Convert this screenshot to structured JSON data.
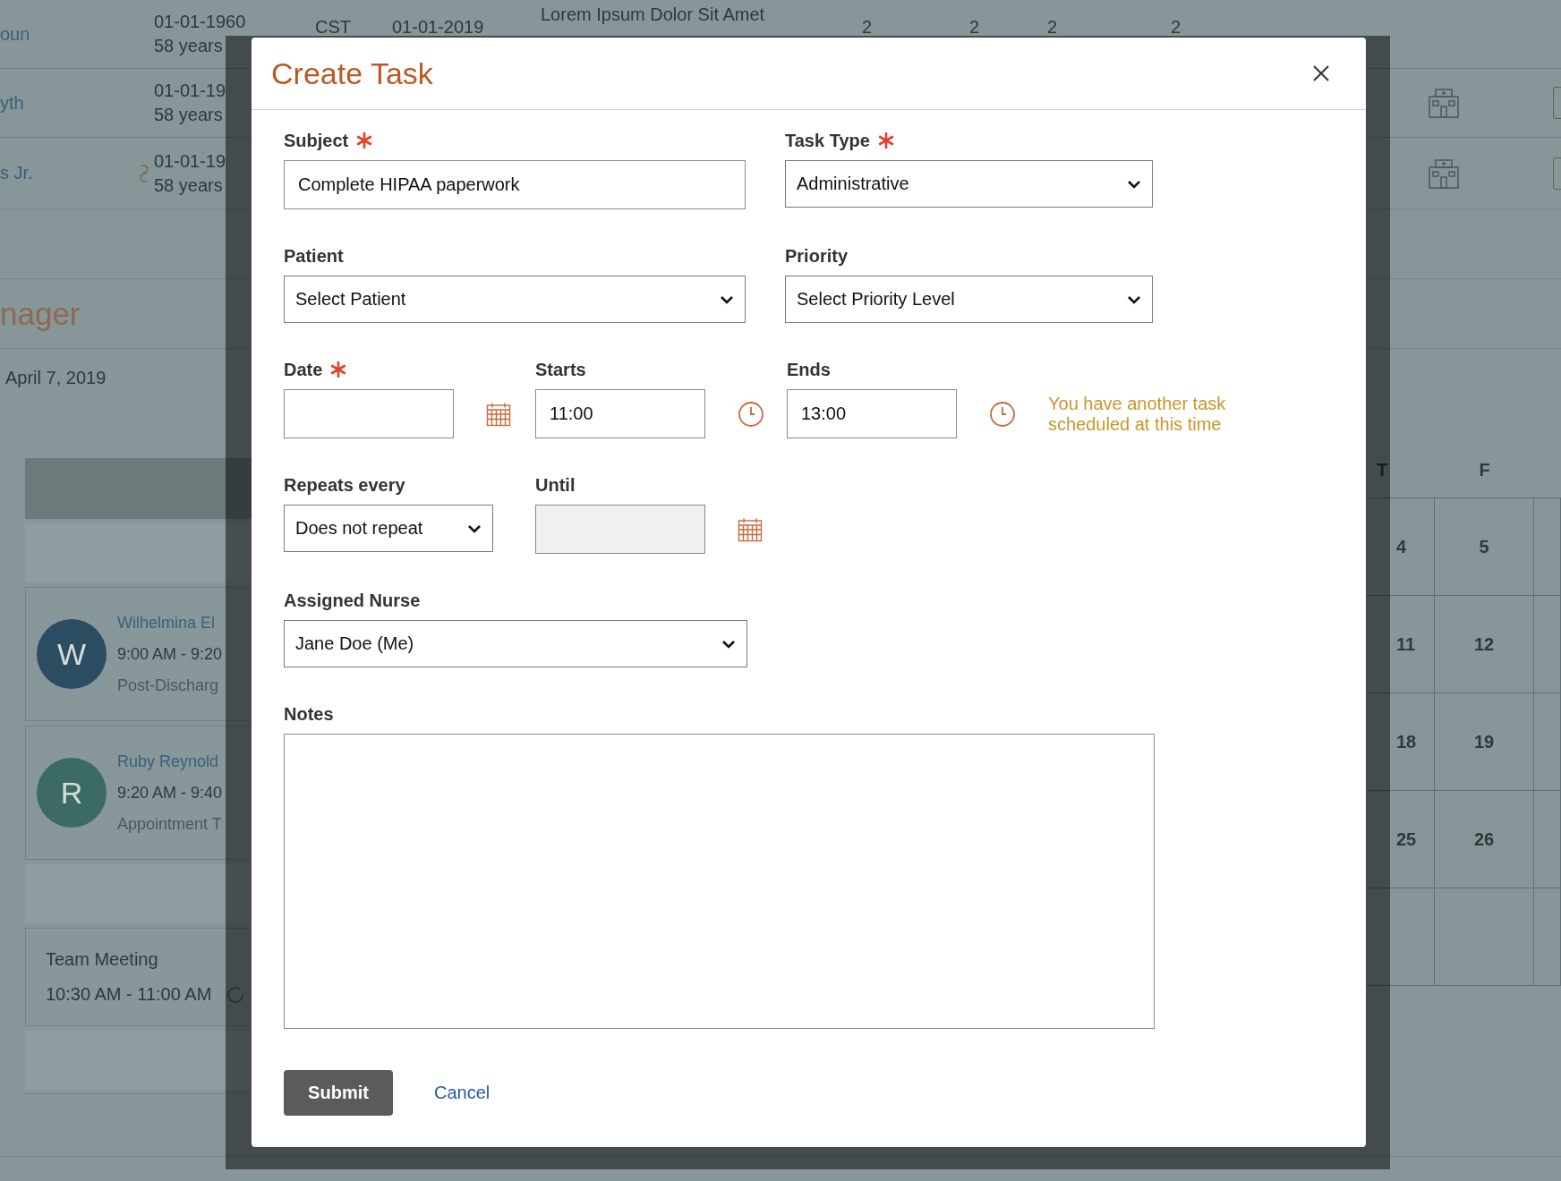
{
  "background": {
    "patient_table": {
      "rows": [
        {
          "name": "oun",
          "linked": false,
          "dob": "01-01-1960",
          "age": "58 years",
          "timezone": "CST",
          "date": "01-01-2019",
          "note": "Lorem Ipsum Dolor Sit Amet",
          "counts": [
            "2",
            "2",
            "2",
            "2"
          ],
          "facility": false
        },
        {
          "name": "yth",
          "linked": false,
          "dob": "01-01-19",
          "age": "58 years",
          "facility": true
        },
        {
          "name": "s Jr.",
          "linked": true,
          "dob": "01-01-19",
          "age": "58 years",
          "facility": true
        }
      ]
    },
    "schedule": {
      "title": "nager",
      "date": "April 7, 2019",
      "items": [
        {
          "kind": "bar"
        },
        {
          "kind": "slot"
        },
        {
          "kind": "appointment",
          "initial": "W",
          "color": "#2c4c62",
          "name": "Wilhelmina El",
          "time": "9:00 AM - 9:20",
          "description": "Post-Discharg"
        },
        {
          "kind": "appointment",
          "initial": "R",
          "color": "#3b6b63",
          "name": "Ruby Reynold",
          "time": "9:20 AM - 9:40",
          "description": "Appointment T"
        },
        {
          "kind": "slot"
        },
        {
          "kind": "event",
          "title": "Team Meeting",
          "time": "10:30 AM - 11:00 AM"
        },
        {
          "kind": "slot"
        }
      ]
    },
    "calendar": {
      "weekdays": [
        "T",
        "F"
      ],
      "weeks": [
        [
          "4",
          "5"
        ],
        [
          "11",
          "12"
        ],
        [
          "18",
          "19"
        ],
        [
          "25",
          "26"
        ]
      ]
    }
  },
  "dialog": {
    "title": "Create Task",
    "rows": [
      [
        {
          "kind": "text",
          "label": "Subject",
          "required": true,
          "value": "Complete HIPAA paperwork"
        },
        {
          "kind": "select",
          "label": "Task Type",
          "required": true,
          "value": "Administrative"
        }
      ],
      [
        {
          "kind": "select",
          "label": "Patient",
          "required": false,
          "value": "Select Patient"
        },
        {
          "kind": "select",
          "label": "Priority",
          "required": false,
          "value": "Select Priority Level"
        }
      ],
      [
        {
          "kind": "date",
          "label": "Date",
          "required": true,
          "disabled": false
        },
        {
          "kind": "time",
          "label": "Starts",
          "required": false,
          "value": "11:00"
        },
        {
          "kind": "time",
          "label": "Ends",
          "required": false,
          "value": "13:00",
          "warning": "You have another task scheduled at this time"
        }
      ],
      [
        {
          "kind": "select",
          "label": "Repeats every",
          "required": false,
          "value": "Does not repeat"
        },
        {
          "kind": "date",
          "label": "Until",
          "required": false,
          "disabled": true
        }
      ],
      [
        {
          "kind": "select",
          "label": "Assigned Nurse",
          "required": false,
          "value": "Jane Doe (Me)"
        }
      ],
      [
        {
          "kind": "textarea",
          "label": "Notes",
          "required": false
        }
      ]
    ],
    "buttons": [
      {
        "kind": "primary",
        "label": "Submit"
      },
      {
        "kind": "link",
        "label": "Cancel"
      }
    ]
  }
}
